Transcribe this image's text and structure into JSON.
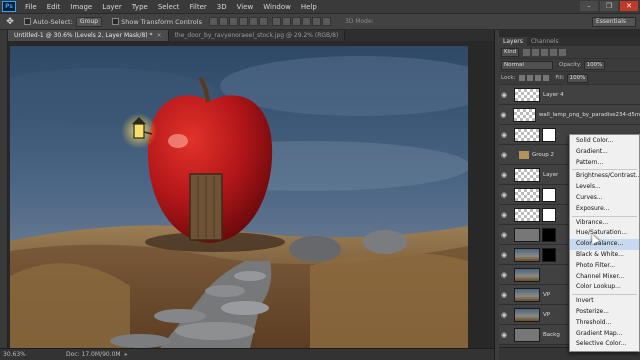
{
  "menubar": {
    "logo": "Ps",
    "items": [
      "File",
      "Edit",
      "Image",
      "Layer",
      "Type",
      "Select",
      "Filter",
      "3D",
      "View",
      "Window",
      "Help"
    ],
    "window_buttons": [
      "–",
      "❐",
      "✕"
    ]
  },
  "options": {
    "auto_select_label": "Auto-Select:",
    "auto_select_value": "Group",
    "transform_label": "Show Transform Controls",
    "mode_3d": "3D Mode:",
    "workspace": "Essentials"
  },
  "tabs": [
    {
      "label": "Untitled-1 @ 30.6% (Levels 2, Layer Mask/8) *",
      "active": true
    },
    {
      "label": "the_door_by_ravyenoraeel_stock.jpg @ 29.2% (RGB/8)",
      "active": false
    }
  ],
  "status": {
    "zoom": "30.63%",
    "doc": "Doc: 17.0M/90.0M"
  },
  "layers_panel": {
    "tabs": [
      "Layers",
      "Channels"
    ],
    "kind_label": "Kind",
    "blend_mode": "Normal",
    "opacity_label": "Opacity:",
    "opacity_value": "100%",
    "lock_label": "Lock:",
    "fill_label": "Fill:",
    "fill_value": "100%",
    "layers": [
      {
        "name": "Layer 4",
        "thumb": "check",
        "mask": ""
      },
      {
        "name": "wall_lamp_png_by_paradise234-d5mlp3m",
        "thumb": "check",
        "mask": ""
      },
      {
        "name": "",
        "thumb": "check",
        "mask": "white"
      },
      {
        "name": "Group 2",
        "thumb": "group",
        "mask": ""
      },
      {
        "name": "Layer",
        "thumb": "check",
        "mask": ""
      },
      {
        "name": "",
        "thumb": "check",
        "mask": "white"
      },
      {
        "name": "",
        "thumb": "check",
        "mask": "white"
      },
      {
        "name": "",
        "thumb": "dark",
        "mask": "black"
      },
      {
        "name": "",
        "thumb": "photo",
        "mask": "black"
      },
      {
        "name": "",
        "thumb": "photo",
        "mask": ""
      },
      {
        "name": "VP",
        "thumb": "photo",
        "mask": ""
      },
      {
        "name": "VP",
        "thumb": "photo",
        "mask": ""
      },
      {
        "name": "Backg",
        "thumb": "dark",
        "mask": ""
      }
    ]
  },
  "adjust_menu": {
    "groups": [
      [
        "Solid Color...",
        "Gradient...",
        "Pattern..."
      ],
      [
        "Brightness/Contrast...",
        "Levels...",
        "Curves...",
        "Exposure..."
      ],
      [
        "Vibrance...",
        "Hue/Saturation...",
        "Color Balance...",
        "Black & White...",
        "Photo Filter...",
        "Channel Mixer...",
        "Color Lookup..."
      ],
      [
        "Invert",
        "Posterize...",
        "Threshold...",
        "Gradient Map...",
        "Selective Color..."
      ]
    ],
    "hovered": "Color Balance..."
  }
}
